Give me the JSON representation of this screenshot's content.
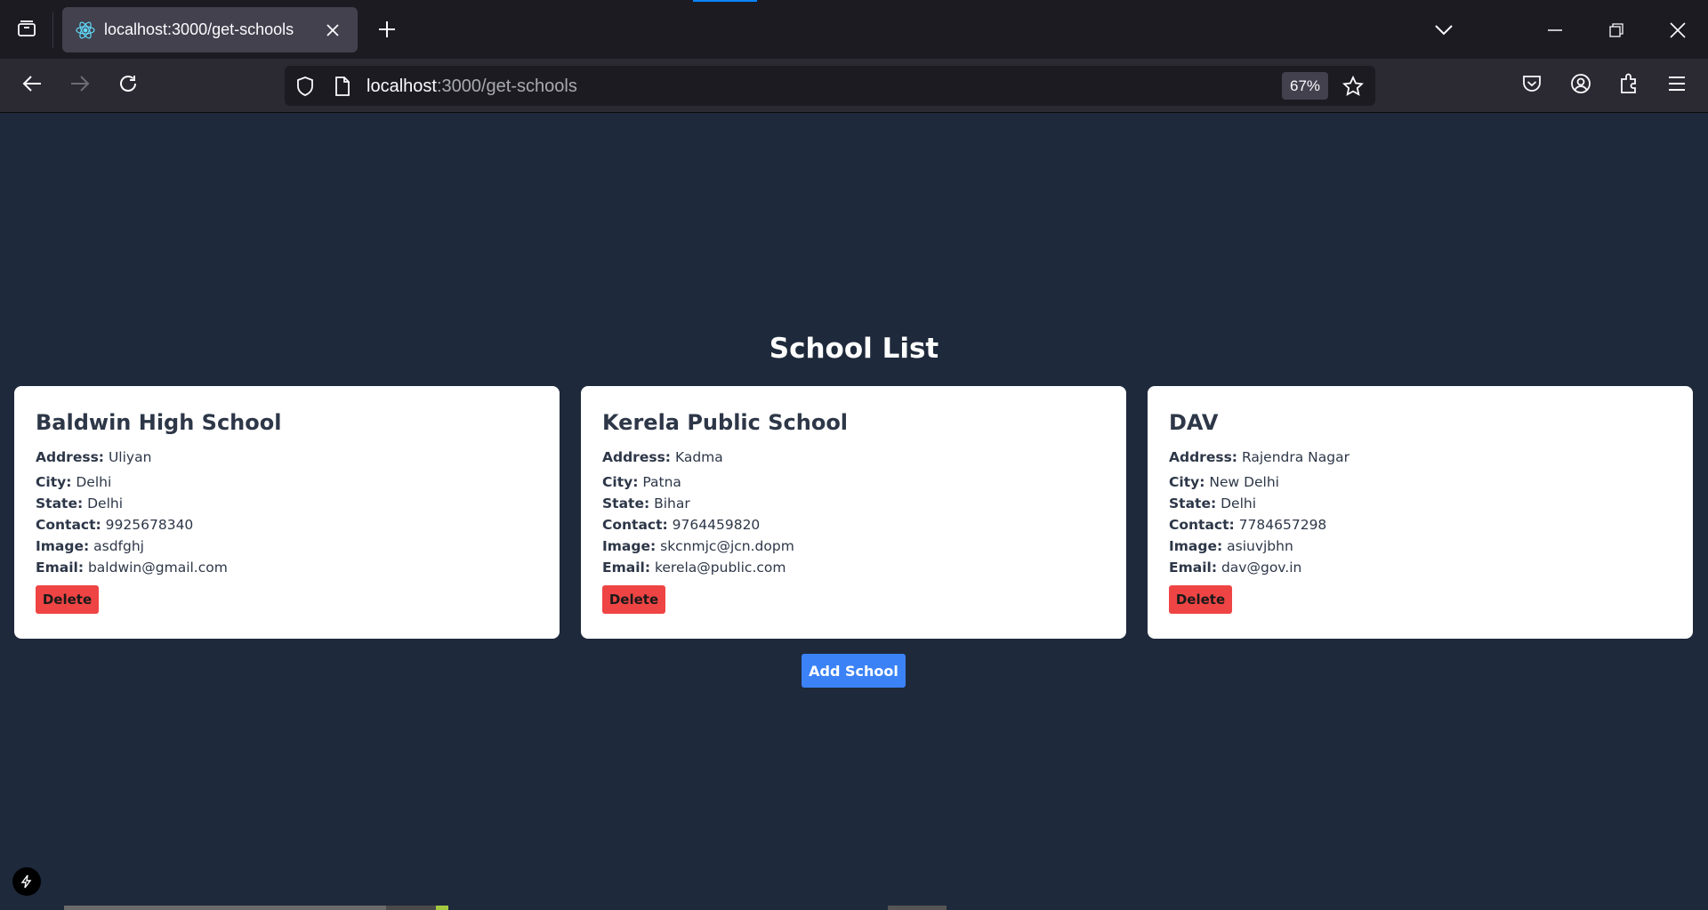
{
  "browser": {
    "tab_title": "localhost:3000/get-schools",
    "url_host": "localhost",
    "url_path": ":3000/get-schools",
    "zoom": "67%"
  },
  "icons": {
    "tab_list": "tab-list-icon",
    "favicon": "react-icon",
    "tab_close": "close-icon",
    "new_tab": "plus-icon",
    "back": "arrow-left-icon",
    "forward": "arrow-right-icon",
    "reload": "reload-icon",
    "shield": "shield-icon",
    "page": "page-icon",
    "bookmark": "star-icon",
    "pocket": "pocket-icon",
    "account": "account-icon",
    "extensions": "puzzle-icon",
    "menu": "hamburger-icon"
  },
  "colors": {
    "page_bg": "#1e293b",
    "card_bg": "#ffffff",
    "delete": "#ef4444",
    "add": "#3b82f6"
  },
  "page": {
    "title": "School List",
    "add_button": "Add School"
  },
  "labels": {
    "address": "Address:",
    "city": "City:",
    "state": "State:",
    "contact": "Contact:",
    "image": "Image:",
    "email": "Email:",
    "delete": "Delete"
  },
  "schools": [
    {
      "name": "Baldwin High School",
      "address": "Uliyan",
      "city": "Delhi",
      "state": "Delhi",
      "contact": "9925678340",
      "image": "asdfghj",
      "email": "baldwin@gmail.com"
    },
    {
      "name": "Kerela Public School",
      "address": "Kadma",
      "city": "Patna",
      "state": "Bihar",
      "contact": "9764459820",
      "image": "skcnmjc@jcn.dopm",
      "email": "kerela@public.com"
    },
    {
      "name": "DAV",
      "address": "Rajendra Nagar",
      "city": "New Delhi",
      "state": "Delhi",
      "contact": "7784657298",
      "image": "asiuvjbhn",
      "email": "dav@gov.in"
    }
  ]
}
